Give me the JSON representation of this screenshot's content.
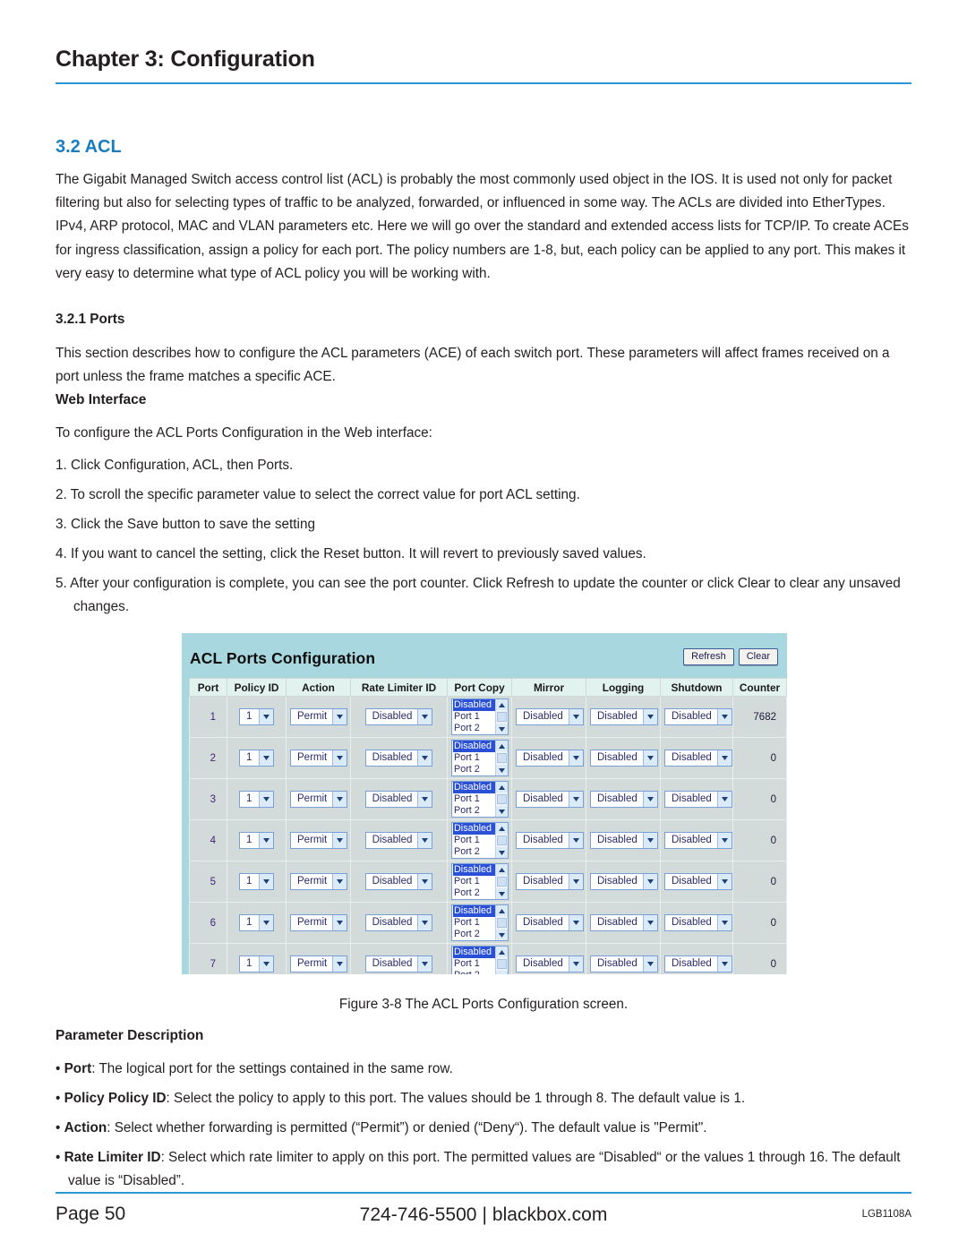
{
  "header": {
    "chapter_title": "Chapter 3: Configuration",
    "section_title": "3.2 ACL"
  },
  "body": {
    "intro_paragraph": "The Gigabit Managed Switch access control list (ACL) is probably the most commonly used object in the IOS. It is used not only for packet filtering but also for selecting types of traffic to be analyzed, forwarded, or influenced in some way. The ACLs are divided into EtherTypes. IPv4, ARP protocol, MAC and VLAN parameters etc. Here we will go over the standard and extended access lists for TCP/IP. To create ACEs for ingress classification, assign a policy for each port. The policy numbers are 1-8, but, each policy can be applied to any port. This makes it very easy to determine what type of ACL policy you will be working with.",
    "subsection_title": "3.2.1 Ports",
    "subsection_paragraph": "This section describes how to configure the ACL parameters (ACE) of each switch port. These parameters will affect frames received on a port unless the frame matches a specific ACE.",
    "web_interface_title": "Web Interface",
    "web_interface_lead": "To configure the ACL Ports Configuration in the Web interface:",
    "steps": [
      "1. Click Configuration, ACL, then Ports.",
      "2. To scroll the specific parameter value to select the correct value for port ACL setting.",
      "3. Click the Save button to save the setting",
      "4. If you want to cancel the setting, click the Reset button. It will revert to previously saved values.",
      "5. After your configuration is complete, you can see the port counter. Click Refresh to update the counter or click Clear to clear any unsaved changes."
    ]
  },
  "figure": {
    "caption": "Figure 3-8 The ACL Ports Configuration screen.",
    "panel_title": "ACL Ports Configuration",
    "panel_bg_color": "#a9d7e0",
    "buttons": [
      {
        "label": "Refresh",
        "name": "refresh-button"
      },
      {
        "label": "Clear",
        "name": "clear-button"
      }
    ],
    "table": {
      "columns": [
        "Port",
        "Policy ID",
        "Action",
        "Rate Limiter ID",
        "Port Copy",
        "Mirror",
        "Logging",
        "Shutdown",
        "Counter"
      ],
      "port_copy_options": [
        "Disabled",
        "Port 1",
        "Port 2"
      ],
      "port_copy_selected": "Disabled",
      "rows": [
        {
          "port": "1",
          "policy_id": "1",
          "action": "Permit",
          "rate_limiter_id": "Disabled",
          "port_copy": "Disabled",
          "mirror": "Disabled",
          "logging": "Disabled",
          "shutdown": "Disabled",
          "counter": "7682"
        },
        {
          "port": "2",
          "policy_id": "1",
          "action": "Permit",
          "rate_limiter_id": "Disabled",
          "port_copy": "Disabled",
          "mirror": "Disabled",
          "logging": "Disabled",
          "shutdown": "Disabled",
          "counter": "0"
        },
        {
          "port": "3",
          "policy_id": "1",
          "action": "Permit",
          "rate_limiter_id": "Disabled",
          "port_copy": "Disabled",
          "mirror": "Disabled",
          "logging": "Disabled",
          "shutdown": "Disabled",
          "counter": "0"
        },
        {
          "port": "4",
          "policy_id": "1",
          "action": "Permit",
          "rate_limiter_id": "Disabled",
          "port_copy": "Disabled",
          "mirror": "Disabled",
          "logging": "Disabled",
          "shutdown": "Disabled",
          "counter": "0"
        },
        {
          "port": "5",
          "policy_id": "1",
          "action": "Permit",
          "rate_limiter_id": "Disabled",
          "port_copy": "Disabled",
          "mirror": "Disabled",
          "logging": "Disabled",
          "shutdown": "Disabled",
          "counter": "0"
        },
        {
          "port": "6",
          "policy_id": "1",
          "action": "Permit",
          "rate_limiter_id": "Disabled",
          "port_copy": "Disabled",
          "mirror": "Disabled",
          "logging": "Disabled",
          "shutdown": "Disabled",
          "counter": "0"
        },
        {
          "port": "7",
          "policy_id": "1",
          "action": "Permit",
          "rate_limiter_id": "Disabled",
          "port_copy": "Disabled",
          "mirror": "Disabled",
          "logging": "Disabled",
          "shutdown": "Disabled",
          "counter": "0"
        }
      ]
    }
  },
  "parameters": {
    "title": "Parameter Description",
    "items": [
      {
        "term": "Port",
        "text": ": The logical port for the settings contained in the same row."
      },
      {
        "term": "Policy Policy ID",
        "text": ": Select the policy to apply to this port. The values should be 1 through 8. The default value is 1."
      },
      {
        "term": "Action",
        "text": ": Select whether forwarding is permitted (“Permit”) or denied (“Deny“). The default value is \"Permit\"."
      },
      {
        "term": "Rate Limiter ID",
        "text": ": Select which rate limiter to apply on this port. The permitted values are “Disabled“ or the values 1 through 16. The default value is “Disabled”."
      }
    ]
  },
  "footer": {
    "page_label": "Page 50",
    "phone": "724-746-5500",
    "separator": "|",
    "website": "blackbox.com",
    "model": "LGB1108A",
    "rule_color": "#2b96d4"
  }
}
